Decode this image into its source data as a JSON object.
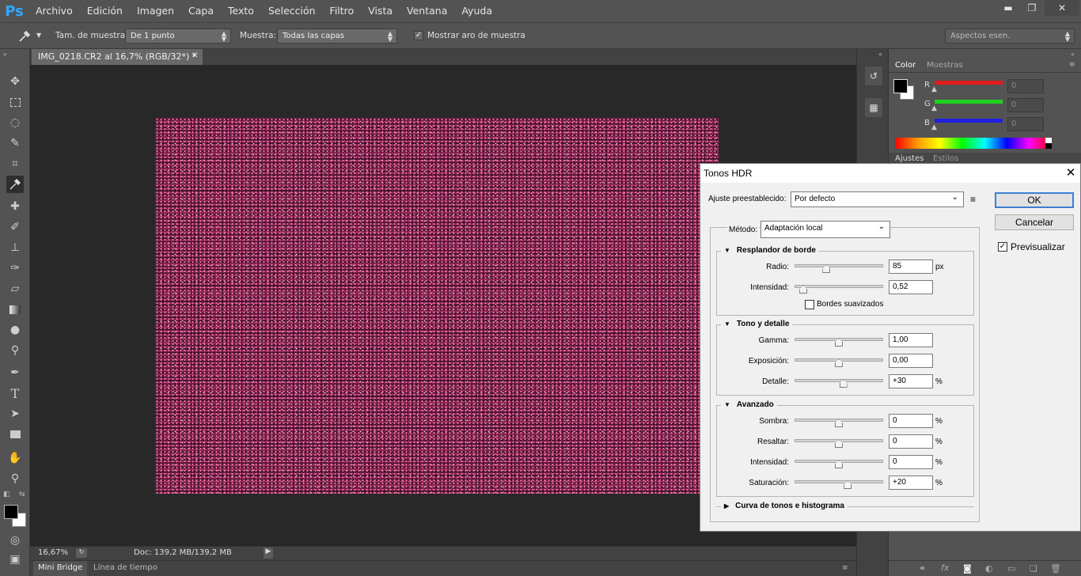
{
  "app": {
    "logo": "Ps",
    "menu": [
      "Archivo",
      "Edición",
      "Imagen",
      "Capa",
      "Texto",
      "Selección",
      "Filtro",
      "Vista",
      "Ventana",
      "Ayuda"
    ],
    "window_controls": {
      "minimize": "▬",
      "restore": "❐",
      "close": "✕"
    }
  },
  "options_bar": {
    "tool_icon": "eyedropper-icon",
    "sample_size_label": "Tam. de muestra:",
    "sample_size_value": "De 1 punto",
    "sample_label": "Muestra:",
    "sample_value": "Todas las capas",
    "show_ring_label": "Mostrar aro de muestra",
    "show_ring_checked": true,
    "workspace_value": "Aspectos esen."
  },
  "document": {
    "tab_title": "IMG_0218.CR2 al 16,7% (RGB/32*) *",
    "zoom": "16,67%",
    "doc_info": "Doc: 139,2 MB/139,2 MB"
  },
  "bottom_tabs": [
    "Mini Bridge",
    "Línea de tiempo"
  ],
  "color_panel": {
    "tabs": [
      "Color",
      "Muestras"
    ],
    "channels": [
      {
        "label": "R",
        "value": "0",
        "color": "#e21b1b"
      },
      {
        "label": "G",
        "value": "0",
        "color": "#1fd01f"
      },
      {
        "label": "B",
        "value": "0",
        "color": "#2020e0"
      }
    ],
    "lower_tabs": [
      "Ajustes",
      "Estilos"
    ]
  },
  "dialog": {
    "title": "Tonos HDR",
    "preset_label": "Ajuste preestablecido:",
    "preset_value": "Por defecto",
    "ok": "OK",
    "cancel": "Cancelar",
    "preview_label": "Previsualizar",
    "preview_checked": true,
    "method_label": "Método:",
    "method_value": "Adaptación local",
    "edge_glow": {
      "title": "Resplandor de borde",
      "radius_label": "Radio:",
      "radius_value": "85",
      "radius_unit": "px",
      "radius_pos": 0.36,
      "strength_label": "Intensidad:",
      "strength_value": "0,52",
      "strength_pos": 0.1,
      "smooth_label": "Bordes suavizados",
      "smooth_checked": false
    },
    "tone_detail": {
      "title": "Tono y detalle",
      "gamma_label": "Gamma:",
      "gamma_value": "1,00",
      "gamma_pos": 0.5,
      "exposure_label": "Exposición:",
      "exposure_value": "0,00",
      "exposure_pos": 0.5,
      "detail_label": "Detalle:",
      "detail_value": "+30",
      "detail_unit": "%",
      "detail_pos": 0.55
    },
    "advanced": {
      "title": "Avanzado",
      "shadow_label": "Sombra:",
      "shadow_value": "0",
      "shadow_pos": 0.5,
      "highlight_label": "Resaltar:",
      "highlight_value": "0",
      "highlight_pos": 0.5,
      "vibrance_label": "Intensidad:",
      "vibrance_value": "0",
      "vibrance_pos": 0.5,
      "saturation_label": "Saturación:",
      "saturation_value": "+20",
      "saturation_pos": 0.6,
      "unit": "%"
    },
    "curve_title": "Curva de tonos e histograma"
  }
}
